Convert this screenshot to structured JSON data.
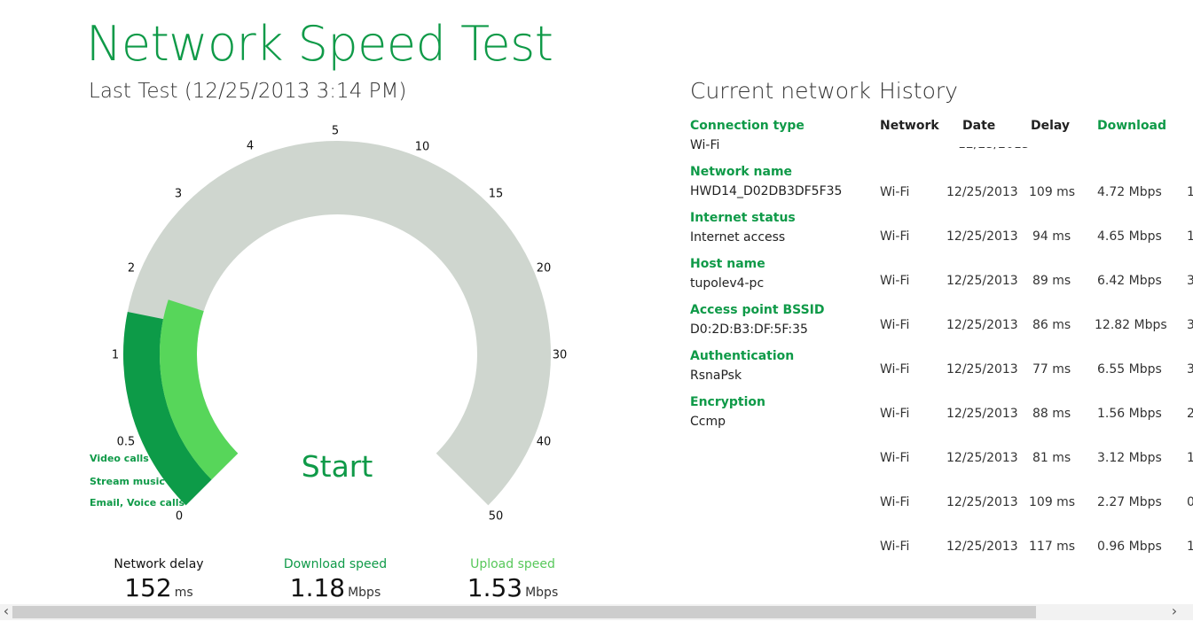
{
  "app": {
    "title": "Network Speed Test",
    "last_test": "Last Test (12/25/2013 3:14 PM)"
  },
  "gauge": {
    "scale_labels": [
      "0",
      "0.5",
      "1",
      "2",
      "3",
      "4",
      "5",
      "10",
      "15",
      "20",
      "30",
      "40",
      "50"
    ],
    "usage_labels": [
      "Video calls",
      "Stream music",
      "Email, Voice calls"
    ],
    "start_label": "Start",
    "colors": {
      "track": "#cfd6cf",
      "download": "#0d9b48",
      "upload": "#57d65a",
      "accent": "#0f9a48"
    }
  },
  "stats": {
    "delay": {
      "label": "Network delay",
      "value": "152",
      "unit": "ms"
    },
    "download": {
      "label": "Download speed",
      "value": "1.18",
      "unit": "Mbps"
    },
    "upload": {
      "label": "Upload speed",
      "value": "1.53",
      "unit": "Mbps"
    }
  },
  "current_network": {
    "heading": "Current network",
    "fields": [
      {
        "label": "Connection type",
        "value": "Wi-Fi"
      },
      {
        "label": "Network name",
        "value": "HWD14_D02DB3DF5F35"
      },
      {
        "label": "Internet status",
        "value": "Internet access"
      },
      {
        "label": "Host name",
        "value": "tupolev4-pc"
      },
      {
        "label": "Access point BSSID",
        "value": "D0:2D:B3:DF:5F:35"
      },
      {
        "label": "Authentication",
        "value": "RsnaPsk"
      },
      {
        "label": "Encryption",
        "value": "Ccmp"
      }
    ]
  },
  "history": {
    "heading": "History",
    "columns": [
      "Network",
      "Date",
      "Delay",
      "Download"
    ],
    "rows": [
      {
        "network": "Wi-Fi",
        "date": "12/25/2013",
        "delay": "109 ms",
        "download": "4.72 Mbps",
        "upload": "1"
      },
      {
        "network": "Wi-Fi",
        "date": "12/25/2013",
        "delay": "94 ms",
        "download": "4.65 Mbps",
        "upload": "1"
      },
      {
        "network": "Wi-Fi",
        "date": "12/25/2013",
        "delay": "89 ms",
        "download": "6.42 Mbps",
        "upload": "3"
      },
      {
        "network": "Wi-Fi",
        "date": "12/25/2013",
        "delay": "86 ms",
        "download": "12.82 Mbps",
        "upload": "3"
      },
      {
        "network": "Wi-Fi",
        "date": "12/25/2013",
        "delay": "77 ms",
        "download": "6.55 Mbps",
        "upload": "3"
      },
      {
        "network": "Wi-Fi",
        "date": "12/25/2013",
        "delay": "88 ms",
        "download": "1.56 Mbps",
        "upload": "2"
      },
      {
        "network": "Wi-Fi",
        "date": "12/25/2013",
        "delay": "81 ms",
        "download": "3.12 Mbps",
        "upload": "1"
      },
      {
        "network": "Wi-Fi",
        "date": "12/25/2013",
        "delay": "109 ms",
        "download": "2.27 Mbps",
        "upload": "0"
      },
      {
        "network": "Wi-Fi",
        "date": "12/25/2013",
        "delay": "117 ms",
        "download": "0.96 Mbps",
        "upload": "1"
      }
    ]
  },
  "scrollbar": {
    "left_arrow": "‹",
    "right_arrow": "›"
  }
}
